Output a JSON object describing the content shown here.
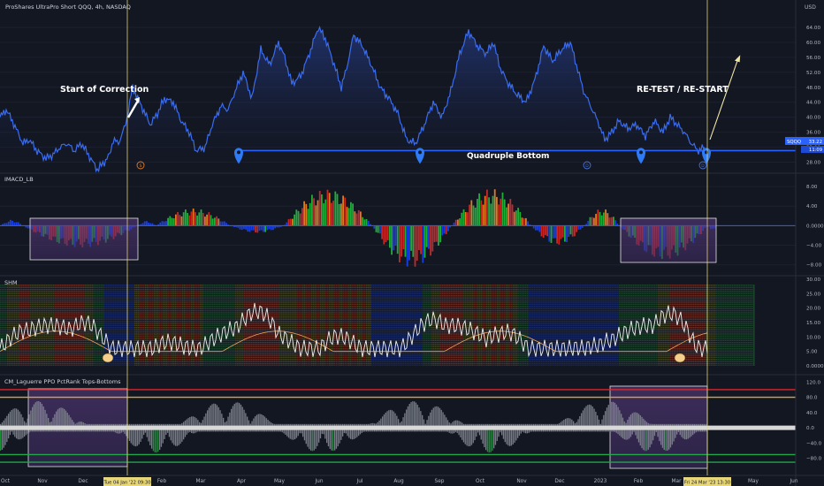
{
  "header": {
    "title": "ProShares UltraPro Short QQQ, 4h, NASDAQ",
    "currency": "USD"
  },
  "annotations": {
    "start": "Start of Correction",
    "retest": "RE-TEST / RE-START",
    "quad": "Quadruple Bottom",
    "marker_s": "S",
    "marker_d": "D"
  },
  "badges": {
    "symbol": "SQQQ",
    "price": "33.22",
    "price_sub": "11:09",
    "date_left": "Tue 04 Jan '22  09:30",
    "date_right": "Fri 24 Mar '23  13:30"
  },
  "colors": {
    "bg": "#131722",
    "price_line": "#2f5fe0",
    "support": "#2962ff",
    "bull": "#089981",
    "bear": "#d81e2a",
    "cross": "#e8d77a",
    "purple": "#5d3f86",
    "red_line": "#e0262e",
    "orange_line": "#e8a22a",
    "green_line": "#1fa84a"
  },
  "chart_data": [
    {
      "type": "line",
      "name": "price",
      "x_labels": [
        "Oct",
        "Nov",
        "Dec",
        "Feb",
        "Mar",
        "Apr",
        "May",
        "Jun",
        "Jul",
        "Aug",
        "Sep",
        "Oct",
        "Nov",
        "Dec",
        "2023",
        "Feb",
        "Mar",
        "Apr",
        "May",
        "Jun"
      ],
      "x": [
        0,
        7,
        14,
        20,
        26,
        33,
        42,
        52,
        60,
        68,
        76,
        84,
        92,
        100,
        110,
        118,
        124,
        128,
        134,
        142,
        150,
        160,
        170,
        178,
        186,
        196,
        205,
        214,
        222,
        232,
        240,
        250,
        258,
        266,
        275,
        285,
        295,
        305,
        315,
        322,
        330,
        340,
        350,
        360,
        368,
        378,
        386,
        392,
        400,
        410,
        420,
        430,
        440,
        450,
        460,
        470,
        480,
        490,
        500,
        510,
        520,
        530,
        540,
        550,
        558,
        566,
        575,
        585,
        595,
        605,
        615,
        625,
        635,
        645,
        652,
        660,
        668,
        676,
        684,
        692,
        700,
        710,
        720,
        730,
        740,
        750,
        758,
        766,
        774,
        782,
        790,
        797
      ],
      "y": [
        40,
        42,
        39,
        36,
        33,
        34,
        31,
        29,
        30,
        32,
        33,
        31,
        33,
        30,
        26,
        28,
        30,
        34,
        33,
        38,
        48,
        43,
        38,
        41,
        45,
        44,
        39,
        36,
        31,
        32,
        38,
        43,
        42,
        47,
        52,
        45,
        58,
        54,
        60,
        56,
        49,
        51,
        57,
        64,
        61,
        54,
        48,
        53,
        62,
        59,
        54,
        48,
        45,
        41,
        34,
        33,
        38,
        44,
        40,
        47,
        57,
        63,
        59,
        57,
        60,
        53,
        49,
        46,
        44,
        50,
        59,
        55,
        58,
        60,
        54,
        47,
        43,
        39,
        34,
        36,
        39,
        37,
        38,
        35,
        39,
        36,
        40,
        38,
        36,
        33,
        31,
        32
      ],
      "y_ticks": [
        28,
        32,
        36,
        40,
        44,
        48,
        52,
        56,
        60,
        64
      ],
      "ylim": [
        26,
        68
      ],
      "support_level": 31.09,
      "last_price": 33.22
    },
    {
      "type": "bar",
      "name": "IMACD_LB",
      "y_ticks": [
        8,
        4,
        0,
        -4,
        -8
      ],
      "ylim": [
        -9.5,
        10
      ]
    },
    {
      "type": "bar",
      "name": "SHM",
      "y_ticks": [
        30,
        25,
        20,
        15,
        10,
        5,
        0
      ],
      "ylim": [
        0,
        30
      ]
    },
    {
      "type": "bar",
      "name": "CM_Laguerre PPO PctRank Tops-Bottoms",
      "y_ticks": [
        120,
        80,
        40,
        0,
        -40,
        -80
      ],
      "ylim": [
        -120,
        130
      ],
      "levels": [
        100,
        80,
        -70,
        -90
      ]
    }
  ],
  "panels": {
    "macd": "IMACD_LB",
    "shm": "SHM",
    "lag": "CM_Laguerre PPO PctRank Tops-Bottoms"
  },
  "ticks": {
    "price": [
      "64.00",
      "60.00",
      "56.00",
      "52.00",
      "48.00",
      "44.00",
      "40.00",
      "36.00",
      "32.00",
      "28.00"
    ],
    "macd": [
      "8.00",
      "4.00",
      "0.0000",
      "−4.00",
      "−8.00"
    ],
    "shm": [
      "30.00",
      "25.00",
      "20.00",
      "15.00",
      "10.00",
      "5.00",
      "0.0000"
    ],
    "lag": [
      "120.0",
      "80.0",
      "40.0",
      "0.0",
      "−40.0",
      "−80.0"
    ]
  }
}
